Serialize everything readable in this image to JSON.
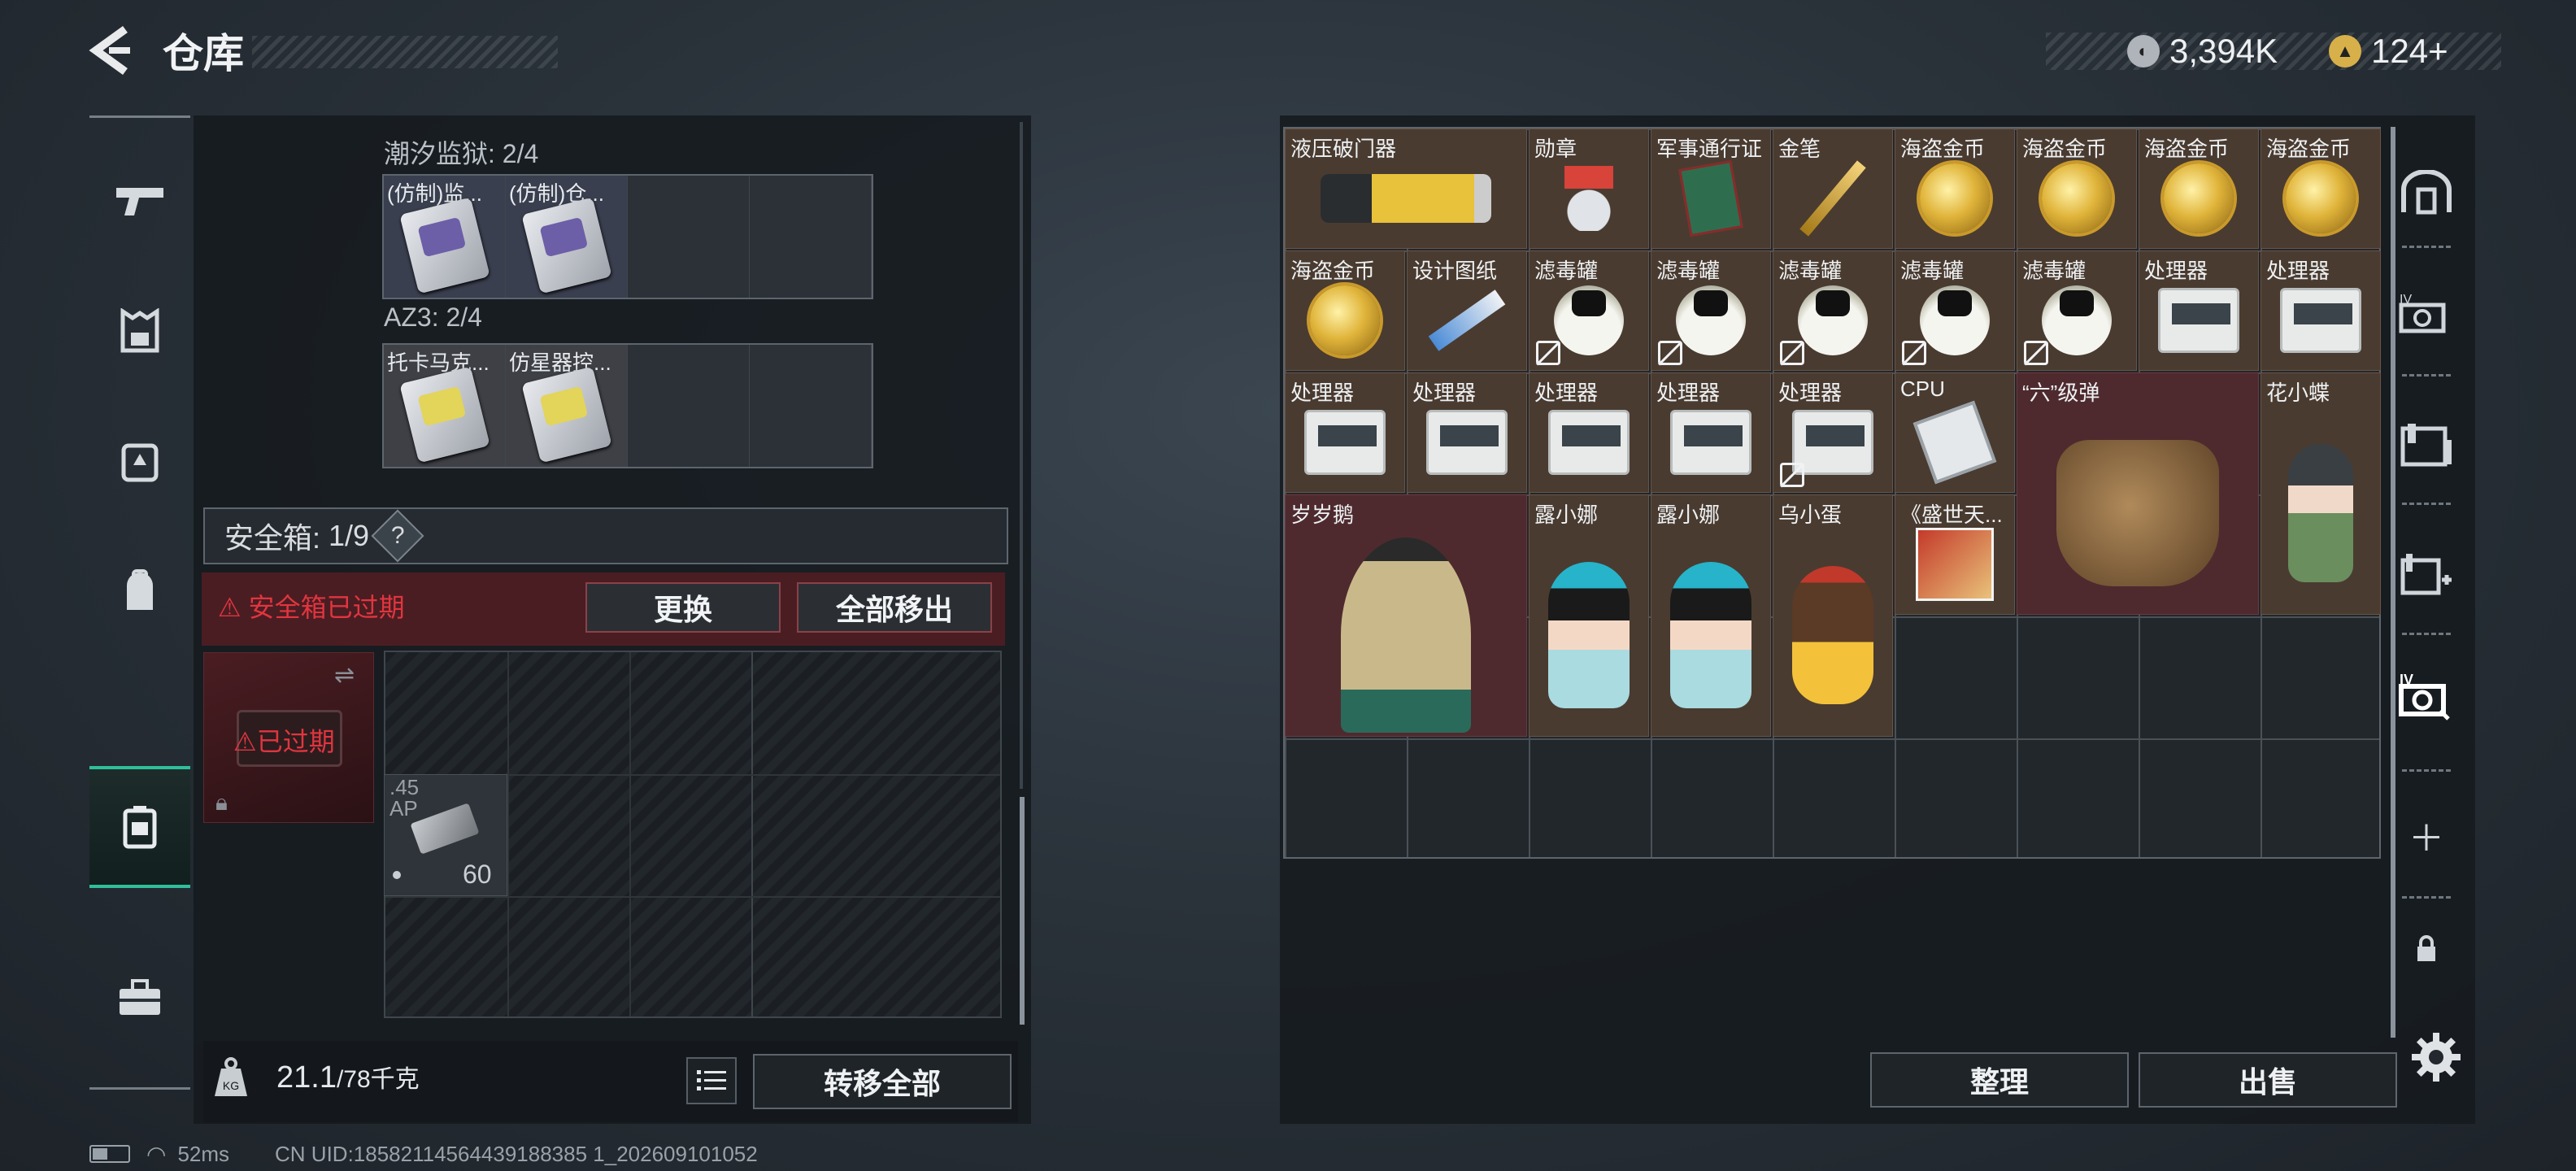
{
  "header": {
    "title": "仓库",
    "back_icon": "back-arrow-icon"
  },
  "currency": {
    "silver": "3,394K",
    "gold": "124+"
  },
  "nav": {
    "items": [
      "guns-icon",
      "armor-icon",
      "chest-rig-icon",
      "backpack-icon",
      "safe-box-icon",
      "toolbox-icon"
    ],
    "active_index": 4
  },
  "left": {
    "section1": {
      "label": "潮汐监狱: 2/4",
      "items": [
        "(仿制)监...",
        "(仿制)仓..."
      ]
    },
    "section2": {
      "label": "AZ3: 2/4",
      "items": [
        "托卡马克...",
        "仿星器控..."
      ]
    },
    "safe": {
      "label": "安全箱:",
      "count": "1/9",
      "help": "?"
    },
    "expired": {
      "warning": "安全箱已过期",
      "replace": "更换",
      "move_all_out": "全部移出",
      "tag": "已过期"
    },
    "ammo": {
      "type": ".45 AP",
      "count": "60"
    },
    "weight": {
      "current": "21.1",
      "max": "/78千克"
    },
    "transfer_all": "转移全部"
  },
  "grid_items": [
    {
      "name": "液压破门器",
      "c": 0,
      "r": 0,
      "w": 2,
      "h": 1,
      "red": false,
      "icon": "hydraulic-breacher-icon"
    },
    {
      "name": "勋章",
      "c": 2,
      "r": 0,
      "w": 1,
      "h": 1,
      "red": false,
      "icon": "medal-icon"
    },
    {
      "name": "军事通行证",
      "c": 3,
      "r": 0,
      "w": 1,
      "h": 1,
      "red": false,
      "icon": "military-pass-icon"
    },
    {
      "name": "金笔",
      "c": 4,
      "r": 0,
      "w": 1,
      "h": 1,
      "red": false,
      "icon": "gold-pen-icon"
    },
    {
      "name": "海盗金币",
      "c": 5,
      "r": 0,
      "w": 1,
      "h": 1,
      "red": false,
      "icon": "gold-coin-icon"
    },
    {
      "name": "海盗金币",
      "c": 6,
      "r": 0,
      "w": 1,
      "h": 1,
      "red": false,
      "icon": "gold-coin-icon"
    },
    {
      "name": "海盗金币",
      "c": 7,
      "r": 0,
      "w": 1,
      "h": 1,
      "red": false,
      "icon": "gold-coin-icon"
    },
    {
      "name": "海盗金币",
      "c": 8,
      "r": 0,
      "w": 1,
      "h": 1,
      "red": false,
      "icon": "gold-coin-icon"
    },
    {
      "name": "海盗金币",
      "c": 0,
      "r": 1,
      "w": 1,
      "h": 1,
      "red": false,
      "icon": "gold-coin-icon"
    },
    {
      "name": "设计图纸",
      "c": 1,
      "r": 1,
      "w": 1,
      "h": 1,
      "red": false,
      "icon": "blueprint-icon"
    },
    {
      "name": "滤毒罐",
      "c": 2,
      "r": 1,
      "w": 1,
      "h": 1,
      "red": false,
      "icon": "gas-filter-icon",
      "broken": true
    },
    {
      "name": "滤毒罐",
      "c": 3,
      "r": 1,
      "w": 1,
      "h": 1,
      "red": false,
      "icon": "gas-filter-icon",
      "broken": true
    },
    {
      "name": "滤毒罐",
      "c": 4,
      "r": 1,
      "w": 1,
      "h": 1,
      "red": false,
      "icon": "gas-filter-icon",
      "broken": true
    },
    {
      "name": "滤毒罐",
      "c": 5,
      "r": 1,
      "w": 1,
      "h": 1,
      "red": false,
      "icon": "gas-filter-icon",
      "broken": true
    },
    {
      "name": "滤毒罐",
      "c": 6,
      "r": 1,
      "w": 1,
      "h": 1,
      "red": false,
      "icon": "gas-filter-icon",
      "broken": true
    },
    {
      "name": "处理器",
      "c": 7,
      "r": 1,
      "w": 1,
      "h": 1,
      "red": false,
      "icon": "processor-icon"
    },
    {
      "name": "处理器",
      "c": 8,
      "r": 1,
      "w": 1,
      "h": 1,
      "red": false,
      "icon": "processor-icon"
    },
    {
      "name": "处理器",
      "c": 0,
      "r": 2,
      "w": 1,
      "h": 1,
      "red": false,
      "icon": "processor-icon"
    },
    {
      "name": "处理器",
      "c": 1,
      "r": 2,
      "w": 1,
      "h": 1,
      "red": false,
      "icon": "processor-icon"
    },
    {
      "name": "处理器",
      "c": 2,
      "r": 2,
      "w": 1,
      "h": 1,
      "red": false,
      "icon": "processor-icon"
    },
    {
      "name": "处理器",
      "c": 3,
      "r": 2,
      "w": 1,
      "h": 1,
      "red": false,
      "icon": "processor-icon"
    },
    {
      "name": "处理器",
      "c": 4,
      "r": 2,
      "w": 1,
      "h": 1,
      "red": false,
      "icon": "processor-icon",
      "broken": true
    },
    {
      "name": "CPU",
      "c": 5,
      "r": 2,
      "w": 1,
      "h": 1,
      "red": false,
      "icon": "cpu-icon"
    },
    {
      "name": "“六”级弹",
      "c": 6,
      "r": 2,
      "w": 2,
      "h": 2,
      "red": true,
      "icon": "bronze-hand-icon"
    },
    {
      "name": "花小蝶",
      "c": 8,
      "r": 2,
      "w": 1,
      "h": 2,
      "red": false,
      "icon": "figurine-icon"
    },
    {
      "name": "岁岁鹅",
      "c": 0,
      "r": 3,
      "w": 2,
      "h": 2,
      "red": true,
      "icon": "goose-statue-icon"
    },
    {
      "name": "露小娜",
      "c": 2,
      "r": 3,
      "w": 1,
      "h": 2,
      "red": false,
      "icon": "doll-icon"
    },
    {
      "name": "露小娜",
      "c": 3,
      "r": 3,
      "w": 1,
      "h": 2,
      "red": false,
      "icon": "doll-icon"
    },
    {
      "name": "乌小蛋",
      "c": 4,
      "r": 3,
      "w": 1,
      "h": 2,
      "red": false,
      "icon": "egg-figure-icon"
    },
    {
      "name": "《盛世天...",
      "c": 5,
      "r": 3,
      "w": 1,
      "h": 1,
      "red": false,
      "icon": "book-icon"
    }
  ],
  "right": {
    "sort": "整理",
    "sell": "出售"
  },
  "status": {
    "ping": "52ms",
    "uid": "CN UID:18582114564439188385 1_202609101052"
  },
  "colors": {
    "accent": "#2fbf9a",
    "warning": "#e1353f",
    "item_bg": "#4a3b30",
    "item_red_bg": "#4e2a2e"
  }
}
